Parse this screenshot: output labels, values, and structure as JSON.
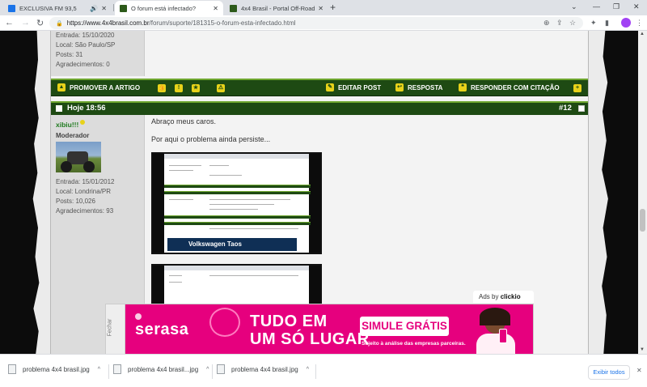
{
  "tabs": [
    {
      "title": "EXCLUSIVA FM 93,5",
      "favicon_color": "#1a73e8",
      "close": "✕",
      "extra": "🔊"
    },
    {
      "title": "O forum está infectado?",
      "favicon_color": "#2d5a1a",
      "close": "✕"
    },
    {
      "title": "4x4 Brasil - Portal Off-Road - Fór",
      "favicon_color": "#2d5a1a",
      "close": "✕"
    }
  ],
  "new_tab": "+",
  "window_controls": {
    "search": "⌄",
    "minimize": "—",
    "maximize": "❐",
    "close": "✕"
  },
  "toolbar": {
    "back": "←",
    "forward": "→",
    "reload": "↻",
    "url_host": "https://www.4x4brasil.com.br",
    "url_path": "/forum/suporte/181315-o-forum-esta-infectado.html",
    "avatar_letter": "●"
  },
  "prev_post": {
    "stats": [
      "Entrada: 15/10/2020",
      "Local: São Paulo/SP",
      "Posts: 31",
      "Agradecimentos: 0"
    ]
  },
  "actionbar": {
    "promote": "PROMOVER A ARTIGO",
    "edit": "EDITAR POST",
    "reply": "RESPOSTA",
    "quote": "RESPONDER COM CITAÇÃO"
  },
  "post": {
    "time": "Hoje 18:56",
    "number": "#12",
    "username": "xibiu!!!",
    "role": "Moderador",
    "stats": [
      "Entrada: 15/01/2012",
      "Local: Londrina/PR",
      "Posts: 10,026",
      "Agradecimentos: 93"
    ],
    "lines": [
      "Abraço meus caros.",
      "Por aqui o problema ainda persiste..."
    ],
    "embedded_ad": "Volkswagen Taos"
  },
  "ad": {
    "fechar": "Fechar",
    "ads_by": "Ads by",
    "ads_brand": "clickio",
    "brand": "serasa",
    "slogan_line1": "TUDO EM",
    "slogan_line2": "UM SÓ LUGAR",
    "cta": "SIMULE GRÁTIS",
    "cta_sub": "Sujeito à análise das empresas parceiras.",
    "close": "✕",
    "color": "#e6007e"
  },
  "downloads": {
    "items": [
      "problema 4x4 brasil.jpg",
      "problema 4x4 brasil...jpg",
      "problema 4x4 brasil.jpg"
    ],
    "chevron": "^",
    "show_all": "Exibir todos",
    "close": "✕"
  },
  "colors": {
    "forum_green": "#1e4a13",
    "accent_green": "#6ea62f",
    "icon_yellow": "#e8d21a"
  }
}
